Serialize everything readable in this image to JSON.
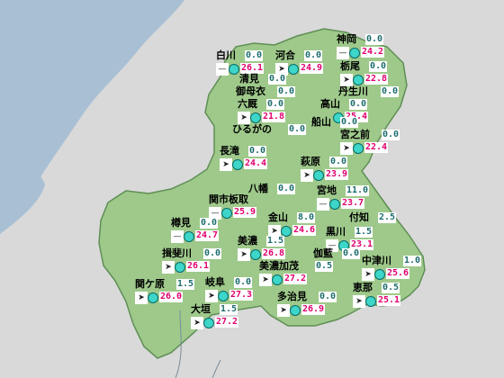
{
  "colors": {
    "sea": "#a9bfd4",
    "land_outside": "#d9d9d9",
    "prefecture": "#9ec98b",
    "border": "#5f8f55",
    "precip_text": "#1e6e6e",
    "temp_text": "#e0006e",
    "sun": "#3dd6c8"
  },
  "stations": [
    {
      "name": "神岡",
      "precip": "0.0",
      "wind": "calm",
      "temp": "24.2"
    },
    {
      "name": "白川",
      "precip": "0.0",
      "wind": "calm",
      "temp": "26.1"
    },
    {
      "name": "河合",
      "precip": "0.0",
      "wind": "arrow",
      "temp": "24.9"
    },
    {
      "name": "栃尾",
      "precip": "0.0",
      "wind": "arrow",
      "temp": "22.8"
    },
    {
      "name": "清見",
      "precip": "0.0"
    },
    {
      "name": "丹生川",
      "precip": "0.0"
    },
    {
      "name": "御母衣",
      "precip": "0.0"
    },
    {
      "name": "六厩",
      "precip": "0.0",
      "wind": "arrow",
      "temp": "21.8"
    },
    {
      "name": "高山",
      "precip": "0.0",
      "temp": "25.4"
    },
    {
      "name": "船山",
      "precip": "0.0"
    },
    {
      "name": "ひるがの",
      "precip": "0.0"
    },
    {
      "name": "宮之前",
      "precip": "0.0",
      "wind": "arrow",
      "temp": "22.4"
    },
    {
      "name": "長滝",
      "precip": "0.0",
      "wind": "arrow",
      "temp": "24.4"
    },
    {
      "name": "萩原",
      "precip": "0.0",
      "wind": "arrow",
      "temp": "23.9"
    },
    {
      "name": "八幡",
      "precip": "0.0"
    },
    {
      "name": "関市板取",
      "wind": "calm",
      "temp": "25.9"
    },
    {
      "name": "宮地",
      "precip": "11.0",
      "wind": "calm",
      "temp": "23.7"
    },
    {
      "name": "金山",
      "precip": "8.0",
      "wind": "arrow",
      "temp": "24.6"
    },
    {
      "name": "付知",
      "precip": "2.5"
    },
    {
      "name": "樽見",
      "precip": "0.0",
      "wind": "calm",
      "temp": "24.7"
    },
    {
      "name": "黒川",
      "precip": "1.5",
      "wind": "calm",
      "temp": "23.1"
    },
    {
      "name": "美濃",
      "precip": "1.5",
      "wind": "arrow",
      "temp": "26.8"
    },
    {
      "name": "伽藍",
      "precip": "0.0"
    },
    {
      "name": "揖斐川",
      "precip": "0.0",
      "wind": "arrow",
      "temp": "26.1"
    },
    {
      "name": "美濃加茂",
      "precip": "0.5",
      "wind": "arrow",
      "temp": "27.2"
    },
    {
      "name": "中津川",
      "precip": "1.0",
      "wind": "arrow",
      "temp": "25.6"
    },
    {
      "name": "関ケ原",
      "precip": "1.5",
      "wind": "arrow",
      "temp": "26.0"
    },
    {
      "name": "岐阜",
      "precip": "0.0",
      "wind": "arrow",
      "temp": "27.3"
    },
    {
      "name": "恵那",
      "precip": "0.5",
      "wind": "arrow",
      "temp": "25.1"
    },
    {
      "name": "大垣",
      "precip": "1.5",
      "wind": "arrow",
      "temp": "27.2"
    },
    {
      "name": "多治見",
      "precip": "0.0",
      "wind": "arrow",
      "temp": "26.9"
    }
  ]
}
